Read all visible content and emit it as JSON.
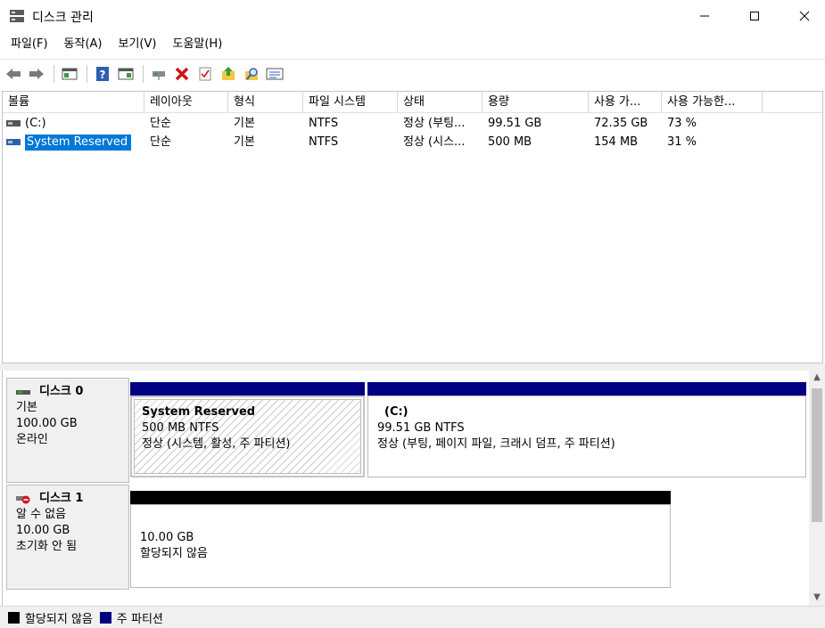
{
  "window": {
    "title": "디스크 관리",
    "icon": "disk-management-icon"
  },
  "menu": [
    "파일(F)",
    "동작(A)",
    "보기(V)",
    "도움말(H)"
  ],
  "toolbar": {
    "icons": [
      "back-arrow-icon",
      "forward-arrow-icon",
      "console-view-icon",
      "help-icon",
      "properties-view-icon",
      "connect-icon",
      "delete-icon",
      "check-icon",
      "up-folder-icon",
      "search-folder-icon",
      "list-icon"
    ]
  },
  "volume_list": {
    "columns": [
      "볼륨",
      "레이아웃",
      "형식",
      "파일 시스템",
      "상태",
      "용량",
      "사용 가...",
      "사용 가능한..."
    ],
    "rows": [
      {
        "volume": "(C:)",
        "layout": "단순",
        "type": "기본",
        "fs": "NTFS",
        "status": "정상 (부팅...",
        "capacity": "99.51 GB",
        "free": "72.35 GB",
        "pct": "73 %"
      },
      {
        "volume": "System Reserved",
        "layout": "단순",
        "type": "기본",
        "fs": "NTFS",
        "status": "정상 (시스...",
        "capacity": "500 MB",
        "free": "154 MB",
        "pct": "31 %"
      }
    ]
  },
  "disks": [
    {
      "name": "디스크 0",
      "kind": "기본",
      "size": "100.00 GB",
      "state": "온라인",
      "partitions": [
        {
          "title": "System Reserved",
          "line1": "500 MB NTFS",
          "line2": "정상 (시스템, 활성, 주 파티션)"
        },
        {
          "title": "(C:)",
          "line1": "99.51 GB NTFS",
          "line2": "정상 (부팅, 페이지 파일, 크래시 덤프, 주 파티션)"
        }
      ]
    },
    {
      "name": "디스크 1",
      "kind": "알 수 없음",
      "size": "10.00 GB",
      "state": "초기화 안 됨",
      "partitions": [
        {
          "title": "",
          "line1": "10.00 GB",
          "line2": "할당되지 않음"
        }
      ]
    }
  ],
  "legend": [
    {
      "label": "할당되지 않음",
      "color": "#000000"
    },
    {
      "label": "주 파티션",
      "color": "#000080"
    }
  ],
  "colors": {
    "primary_partition": "#000080",
    "unallocated": "#000000",
    "selection": "#0078d7"
  }
}
